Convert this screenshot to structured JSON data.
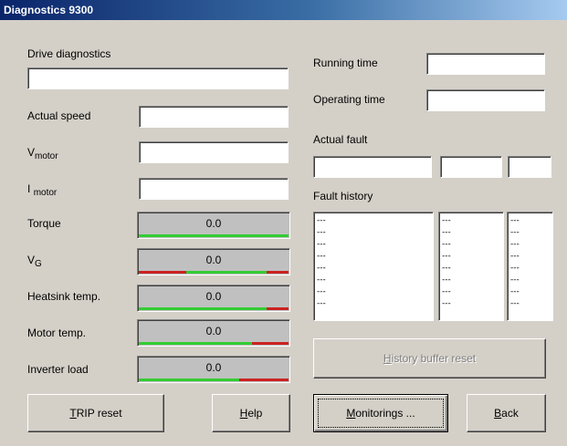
{
  "window": {
    "title": "Diagnostics 9300"
  },
  "labels": {
    "drive_diagnostics": "Drive diagnostics",
    "actual_speed": "Actual speed",
    "v_motor_main": "V",
    "v_motor_sub": "motor",
    "i_motor_main": "I",
    "i_motor_sub": "motor",
    "torque": "Torque",
    "vg_main": "V",
    "vg_sub": "G",
    "heatsink_temp": "Heatsink temp.",
    "motor_temp": "Motor temp.",
    "inverter_load": "Inverter load",
    "running_time": "Running time",
    "operating_time": "Operating time",
    "actual_fault": "Actual fault",
    "fault_history": "Fault history"
  },
  "fields": {
    "drive_diagnostics": "",
    "actual_speed": "",
    "v_motor": "",
    "i_motor": "",
    "running_time": "",
    "operating_time": "",
    "actual_fault_1": "",
    "actual_fault_2": "",
    "actual_fault_3": ""
  },
  "gauges": {
    "torque": {
      "value": "0.0"
    },
    "vg": {
      "value": "0.0"
    },
    "heatsink_temp": {
      "value": "0.0"
    },
    "motor_temp": {
      "value": "0.0"
    },
    "inverter_load": {
      "value": "0.0"
    }
  },
  "colors": {
    "ok": "#33cc33",
    "alarm": "#cc2222",
    "title_start": "#0a246a",
    "title_end": "#a6caf0"
  },
  "fault_history": {
    "col1": [
      "---",
      "---",
      "---",
      "---",
      "---",
      "---",
      "---",
      "---"
    ],
    "col2": [
      "---",
      "---",
      "---",
      "---",
      "---",
      "---",
      "---",
      "---"
    ],
    "col3": [
      "---",
      "---",
      "---",
      "---",
      "---",
      "---",
      "---",
      "---"
    ]
  },
  "buttons": {
    "trip_reset_u": "T",
    "trip_reset_rest": "RIP reset",
    "help_u": "H",
    "help_rest": "elp",
    "monitorings_u": "M",
    "monitorings_rest": "onitorings ...",
    "back_u": "B",
    "back_rest": "ack",
    "history_reset_u": "H",
    "history_reset_rest": "istory buffer reset"
  }
}
